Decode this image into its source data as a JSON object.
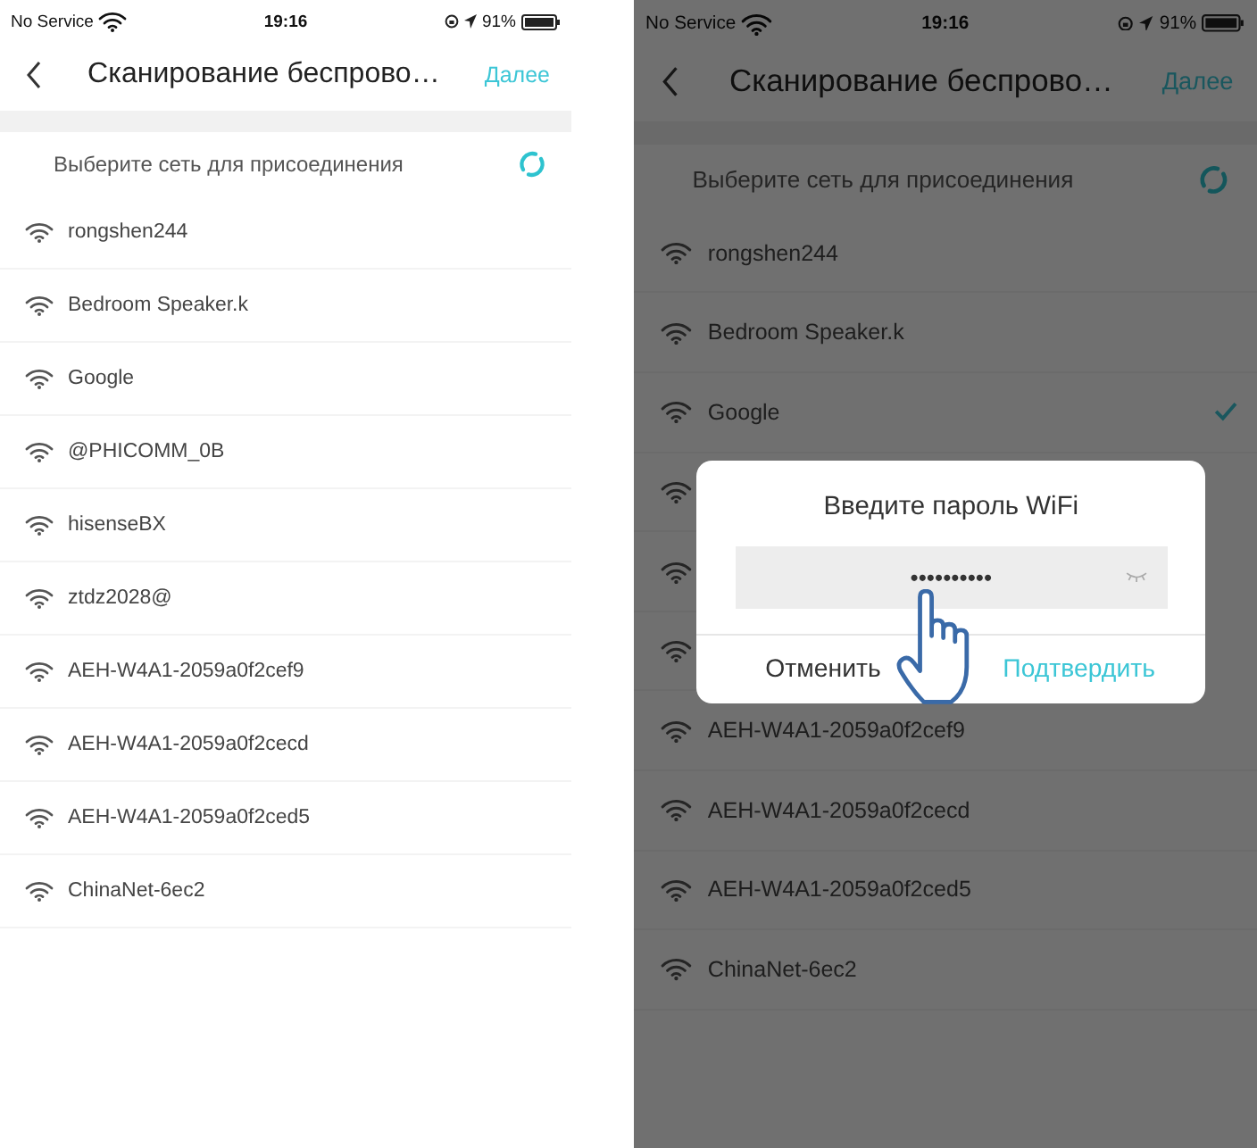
{
  "screens": [
    {
      "status_bar": {
        "carrier": "No Service",
        "time": "19:16",
        "battery": "91%"
      },
      "nav": {
        "title": "Сканирование беспрово…",
        "next": "Далее"
      },
      "section_label": "Выберите сеть для присоединения",
      "dimmed": false,
      "networks": [
        {
          "kind": "network",
          "name": "rongshen244",
          "selected": false
        },
        {
          "kind": "network",
          "name": "Bedroom Speaker.k",
          "selected": false
        },
        {
          "kind": "network",
          "name": "Google",
          "selected": false
        },
        {
          "kind": "network",
          "name": "@PHICOMM_0B",
          "selected": false
        },
        {
          "kind": "network",
          "name": "hisenseBX",
          "selected": false
        },
        {
          "kind": "network",
          "name": "ztdz2028@",
          "selected": false
        },
        {
          "kind": "network",
          "name": "AEH-W4A1-2059a0f2cef9",
          "selected": false
        },
        {
          "kind": "network",
          "name": "AEH-W4A1-2059a0f2cecd",
          "selected": false
        },
        {
          "kind": "network",
          "name": "AEH-W4A1-2059a0f2ced5",
          "selected": false
        },
        {
          "kind": "network",
          "name": "ChinaNet-6ec2",
          "selected": false
        }
      ]
    },
    {
      "status_bar": {
        "carrier": "No Service",
        "time": "19:16",
        "battery": "91%"
      },
      "nav": {
        "title": "Сканирование беспрово…",
        "next": "Далее"
      },
      "section_label": "Выберите сеть для присоединения",
      "dimmed": true,
      "networks": [
        {
          "kind": "network",
          "name": "rongshen244",
          "selected": false
        },
        {
          "kind": "network",
          "name": "Bedroom Speaker.k",
          "selected": false
        },
        {
          "kind": "network",
          "name": "Google",
          "selected": true
        },
        {
          "kind": "covered",
          "selected": false
        },
        {
          "kind": "covered",
          "selected": false
        },
        {
          "kind": "covered",
          "selected": false
        },
        {
          "kind": "network",
          "name": "AEH-W4A1-2059a0f2cef9",
          "selected": false
        },
        {
          "kind": "network",
          "name": "AEH-W4A1-2059a0f2cecd",
          "selected": false
        },
        {
          "kind": "network",
          "name": "AEH-W4A1-2059a0f2ced5",
          "selected": false
        },
        {
          "kind": "network",
          "name": "ChinaNet-6ec2",
          "selected": false
        }
      ],
      "dialog": {
        "title": "Введите пароль WiFi",
        "password": "••••••••••",
        "cancel": "Отменить",
        "confirm": "Подтвердить"
      }
    }
  ]
}
